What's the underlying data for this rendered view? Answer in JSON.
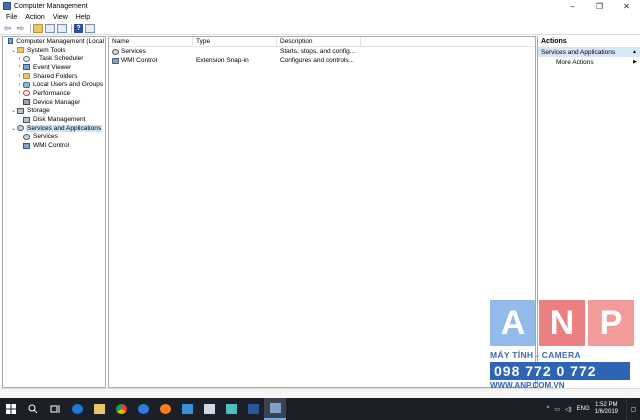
{
  "window": {
    "title": "Computer Management",
    "controls": {
      "minimize": "–",
      "maximize": "❐",
      "close": "✕"
    }
  },
  "menu": [
    "File",
    "Action",
    "View",
    "Help"
  ],
  "toolbar": {
    "back": "⇦",
    "forward": "⇨",
    "help": "?"
  },
  "tree": [
    {
      "label": "Computer Management (Local",
      "indent": 0,
      "twisty": "",
      "icon": "comp",
      "iconName": "computer-management-icon"
    },
    {
      "label": "System Tools",
      "indent": 1,
      "twisty": "⌄",
      "icon": "folder",
      "iconName": "tools-icon"
    },
    {
      "label": "Task Scheduler",
      "indent": 2,
      "twisty": "›",
      "icon": "clock",
      "iconName": "task-scheduler-icon"
    },
    {
      "label": "Event Viewer",
      "indent": 2,
      "twisty": "›",
      "icon": "comp",
      "iconName": "event-viewer-icon"
    },
    {
      "label": "Shared Folders",
      "indent": 2,
      "twisty": "›",
      "icon": "folder",
      "iconName": "shared-folder-icon"
    },
    {
      "label": "Local Users and Groups",
      "indent": 2,
      "twisty": "›",
      "icon": "users",
      "iconName": "users-icon"
    },
    {
      "label": "Performance",
      "indent": 2,
      "twisty": "›",
      "icon": "perf",
      "iconName": "performance-icon"
    },
    {
      "label": "Device Manager",
      "indent": 2,
      "twisty": "",
      "icon": "dev",
      "iconName": "device-manager-icon"
    },
    {
      "label": "Storage",
      "indent": 1,
      "twisty": "⌄",
      "icon": "disk",
      "iconName": "storage-icon"
    },
    {
      "label": "Disk Management",
      "indent": 2,
      "twisty": "",
      "icon": "disk",
      "iconName": "disk-management-icon"
    },
    {
      "label": "Services and Applications",
      "indent": 1,
      "twisty": "⌄",
      "icon": "gear",
      "iconName": "services-applications-icon",
      "selected": true
    },
    {
      "label": "Services",
      "indent": 2,
      "twisty": "",
      "icon": "gear",
      "iconName": "services-icon"
    },
    {
      "label": "WMI Control",
      "indent": 2,
      "twisty": "",
      "icon": "comp",
      "iconName": "wmi-control-icon"
    }
  ],
  "list": {
    "columns": [
      "Name",
      "Type",
      "Description"
    ],
    "rows": [
      {
        "name": "Services",
        "type": "",
        "description": "Starts, stops, and config..."
      },
      {
        "name": "WMI Control",
        "type": "Extension Snap-in",
        "description": "Configures and controls..."
      }
    ]
  },
  "actions": {
    "title": "Actions",
    "section": "Services and Applications",
    "items": [
      "More Actions"
    ]
  },
  "watermark": {
    "letters": [
      "A",
      "N",
      "P"
    ],
    "colors": [
      "#7fb0e6",
      "#e86a6a",
      "#f08a8a"
    ],
    "subtitle": "MÁY TÍNH - CAMERA",
    "phone": "098 772 0 772",
    "url": "WWW.ANP.COM.VN"
  },
  "taskbar": {
    "tray": {
      "language": "ENG",
      "time": "1:52 PM",
      "date": "1/6/2019"
    }
  }
}
